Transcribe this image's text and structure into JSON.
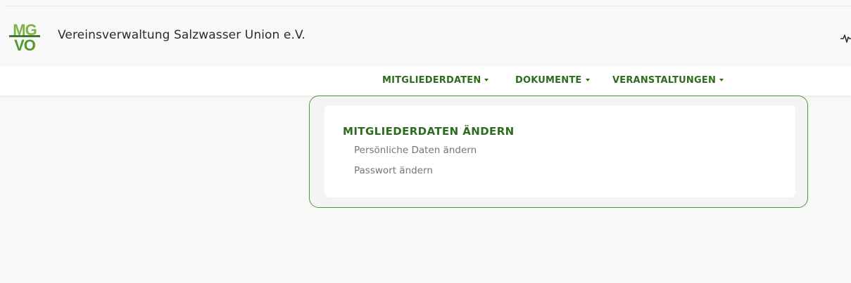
{
  "app": {
    "title": "Vereinsverwaltung Salzwasser Union e.V.",
    "logo_text_top": "MG",
    "logo_text_bottom": "VO",
    "header_icon": "activity-icon"
  },
  "nav": {
    "items": [
      {
        "label": "MITGLIEDERDATEN",
        "icon": "caret-down-icon"
      },
      {
        "label": "DOKUMENTE",
        "icon": "caret-down-icon"
      },
      {
        "label": "VERANSTALTUNGEN",
        "icon": "caret-down-icon"
      }
    ]
  },
  "panel": {
    "title": "MITGLIEDERDATEN ÄNDERN",
    "links": [
      {
        "label": "Persönliche Daten ändern"
      },
      {
        "label": "Passwort ändern"
      }
    ]
  },
  "colors": {
    "accent_green": "#2e6b1f",
    "logo_green_light": "#7cb342",
    "logo_green_dark": "#3d7a2a",
    "panel_border": "#4a9a3a",
    "link_gray": "#757575"
  }
}
